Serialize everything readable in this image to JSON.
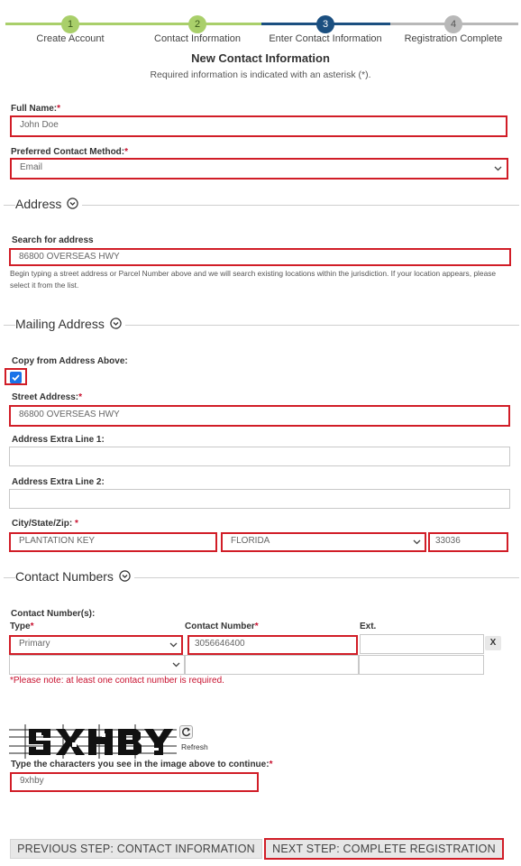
{
  "stepper": {
    "steps": [
      {
        "num": "1",
        "label": "Create Account"
      },
      {
        "num": "2",
        "label": "Contact Information"
      },
      {
        "num": "3",
        "label": "Enter Contact Information"
      },
      {
        "num": "4",
        "label": "Registration Complete"
      }
    ]
  },
  "page": {
    "title": "New Contact Information",
    "subtitle": "Required information is indicated with an asterisk (*)."
  },
  "form": {
    "full_name_label": "Full Name:",
    "full_name_value": "John Doe",
    "contact_method_label": "Preferred Contact Method:",
    "contact_method_value": "Email",
    "address_section": "Address",
    "search_label": "Search for address",
    "search_value": "86800 OVERSEAS HWY",
    "search_help": "Begin typing a street address or Parcel Number above and we will search existing locations within the jurisdiction. If your location appears, please select it from the list.",
    "mailing_section": "Mailing Address",
    "copy_label": "Copy from Address Above:",
    "copy_checked": true,
    "street_label": "Street Address:",
    "street_value": "86800 OVERSEAS HWY",
    "extra1_label": "Address Extra Line 1:",
    "extra1_value": "",
    "extra2_label": "Address Extra Line 2:",
    "extra2_value": "",
    "csz_label": "City/State/Zip:",
    "city_value": "PLANTATION KEY",
    "state_value": "FLORIDA",
    "zip_value": "33036",
    "contact_section": "Contact Numbers",
    "contact_numbers_label": "Contact Number(s):",
    "type_label": "Type",
    "number_label": "Contact Number",
    "ext_label": "Ext.",
    "row1_type": "Primary",
    "row1_number": "3056646400",
    "row1_ext": "",
    "remove_label": "X",
    "row2_type": "",
    "row2_number": "",
    "row2_ext": "",
    "contact_note": "*Please note: at least one contact number is required.",
    "captcha_refresh": "Refresh",
    "captcha_label": "Type the characters you see in the image above to continue:",
    "captcha_value": "9xhby"
  },
  "buttons": {
    "prev": "PREVIOUS STEP: CONTACT INFORMATION",
    "next": "NEXT STEP: COMPLETE REGISTRATION"
  },
  "colors": {
    "done": "#a9cf6a",
    "current": "#1b4f80",
    "todo": "#b8b8b8",
    "highlight": "#d11d27",
    "required": "#c8102e"
  }
}
